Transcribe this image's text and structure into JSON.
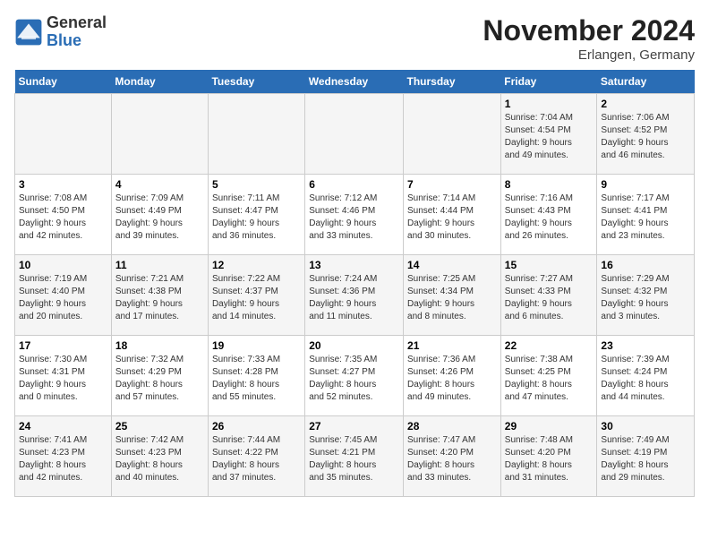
{
  "header": {
    "logo_line1": "General",
    "logo_line2": "Blue",
    "month_title": "November 2024",
    "location": "Erlangen, Germany"
  },
  "weekdays": [
    "Sunday",
    "Monday",
    "Tuesday",
    "Wednesday",
    "Thursday",
    "Friday",
    "Saturday"
  ],
  "weeks": [
    [
      {
        "day": "",
        "info": ""
      },
      {
        "day": "",
        "info": ""
      },
      {
        "day": "",
        "info": ""
      },
      {
        "day": "",
        "info": ""
      },
      {
        "day": "",
        "info": ""
      },
      {
        "day": "1",
        "info": "Sunrise: 7:04 AM\nSunset: 4:54 PM\nDaylight: 9 hours\nand 49 minutes."
      },
      {
        "day": "2",
        "info": "Sunrise: 7:06 AM\nSunset: 4:52 PM\nDaylight: 9 hours\nand 46 minutes."
      }
    ],
    [
      {
        "day": "3",
        "info": "Sunrise: 7:08 AM\nSunset: 4:50 PM\nDaylight: 9 hours\nand 42 minutes."
      },
      {
        "day": "4",
        "info": "Sunrise: 7:09 AM\nSunset: 4:49 PM\nDaylight: 9 hours\nand 39 minutes."
      },
      {
        "day": "5",
        "info": "Sunrise: 7:11 AM\nSunset: 4:47 PM\nDaylight: 9 hours\nand 36 minutes."
      },
      {
        "day": "6",
        "info": "Sunrise: 7:12 AM\nSunset: 4:46 PM\nDaylight: 9 hours\nand 33 minutes."
      },
      {
        "day": "7",
        "info": "Sunrise: 7:14 AM\nSunset: 4:44 PM\nDaylight: 9 hours\nand 30 minutes."
      },
      {
        "day": "8",
        "info": "Sunrise: 7:16 AM\nSunset: 4:43 PM\nDaylight: 9 hours\nand 26 minutes."
      },
      {
        "day": "9",
        "info": "Sunrise: 7:17 AM\nSunset: 4:41 PM\nDaylight: 9 hours\nand 23 minutes."
      }
    ],
    [
      {
        "day": "10",
        "info": "Sunrise: 7:19 AM\nSunset: 4:40 PM\nDaylight: 9 hours\nand 20 minutes."
      },
      {
        "day": "11",
        "info": "Sunrise: 7:21 AM\nSunset: 4:38 PM\nDaylight: 9 hours\nand 17 minutes."
      },
      {
        "day": "12",
        "info": "Sunrise: 7:22 AM\nSunset: 4:37 PM\nDaylight: 9 hours\nand 14 minutes."
      },
      {
        "day": "13",
        "info": "Sunrise: 7:24 AM\nSunset: 4:36 PM\nDaylight: 9 hours\nand 11 minutes."
      },
      {
        "day": "14",
        "info": "Sunrise: 7:25 AM\nSunset: 4:34 PM\nDaylight: 9 hours\nand 8 minutes."
      },
      {
        "day": "15",
        "info": "Sunrise: 7:27 AM\nSunset: 4:33 PM\nDaylight: 9 hours\nand 6 minutes."
      },
      {
        "day": "16",
        "info": "Sunrise: 7:29 AM\nSunset: 4:32 PM\nDaylight: 9 hours\nand 3 minutes."
      }
    ],
    [
      {
        "day": "17",
        "info": "Sunrise: 7:30 AM\nSunset: 4:31 PM\nDaylight: 9 hours\nand 0 minutes."
      },
      {
        "day": "18",
        "info": "Sunrise: 7:32 AM\nSunset: 4:29 PM\nDaylight: 8 hours\nand 57 minutes."
      },
      {
        "day": "19",
        "info": "Sunrise: 7:33 AM\nSunset: 4:28 PM\nDaylight: 8 hours\nand 55 minutes."
      },
      {
        "day": "20",
        "info": "Sunrise: 7:35 AM\nSunset: 4:27 PM\nDaylight: 8 hours\nand 52 minutes."
      },
      {
        "day": "21",
        "info": "Sunrise: 7:36 AM\nSunset: 4:26 PM\nDaylight: 8 hours\nand 49 minutes."
      },
      {
        "day": "22",
        "info": "Sunrise: 7:38 AM\nSunset: 4:25 PM\nDaylight: 8 hours\nand 47 minutes."
      },
      {
        "day": "23",
        "info": "Sunrise: 7:39 AM\nSunset: 4:24 PM\nDaylight: 8 hours\nand 44 minutes."
      }
    ],
    [
      {
        "day": "24",
        "info": "Sunrise: 7:41 AM\nSunset: 4:23 PM\nDaylight: 8 hours\nand 42 minutes."
      },
      {
        "day": "25",
        "info": "Sunrise: 7:42 AM\nSunset: 4:23 PM\nDaylight: 8 hours\nand 40 minutes."
      },
      {
        "day": "26",
        "info": "Sunrise: 7:44 AM\nSunset: 4:22 PM\nDaylight: 8 hours\nand 37 minutes."
      },
      {
        "day": "27",
        "info": "Sunrise: 7:45 AM\nSunset: 4:21 PM\nDaylight: 8 hours\nand 35 minutes."
      },
      {
        "day": "28",
        "info": "Sunrise: 7:47 AM\nSunset: 4:20 PM\nDaylight: 8 hours\nand 33 minutes."
      },
      {
        "day": "29",
        "info": "Sunrise: 7:48 AM\nSunset: 4:20 PM\nDaylight: 8 hours\nand 31 minutes."
      },
      {
        "day": "30",
        "info": "Sunrise: 7:49 AM\nSunset: 4:19 PM\nDaylight: 8 hours\nand 29 minutes."
      }
    ]
  ]
}
